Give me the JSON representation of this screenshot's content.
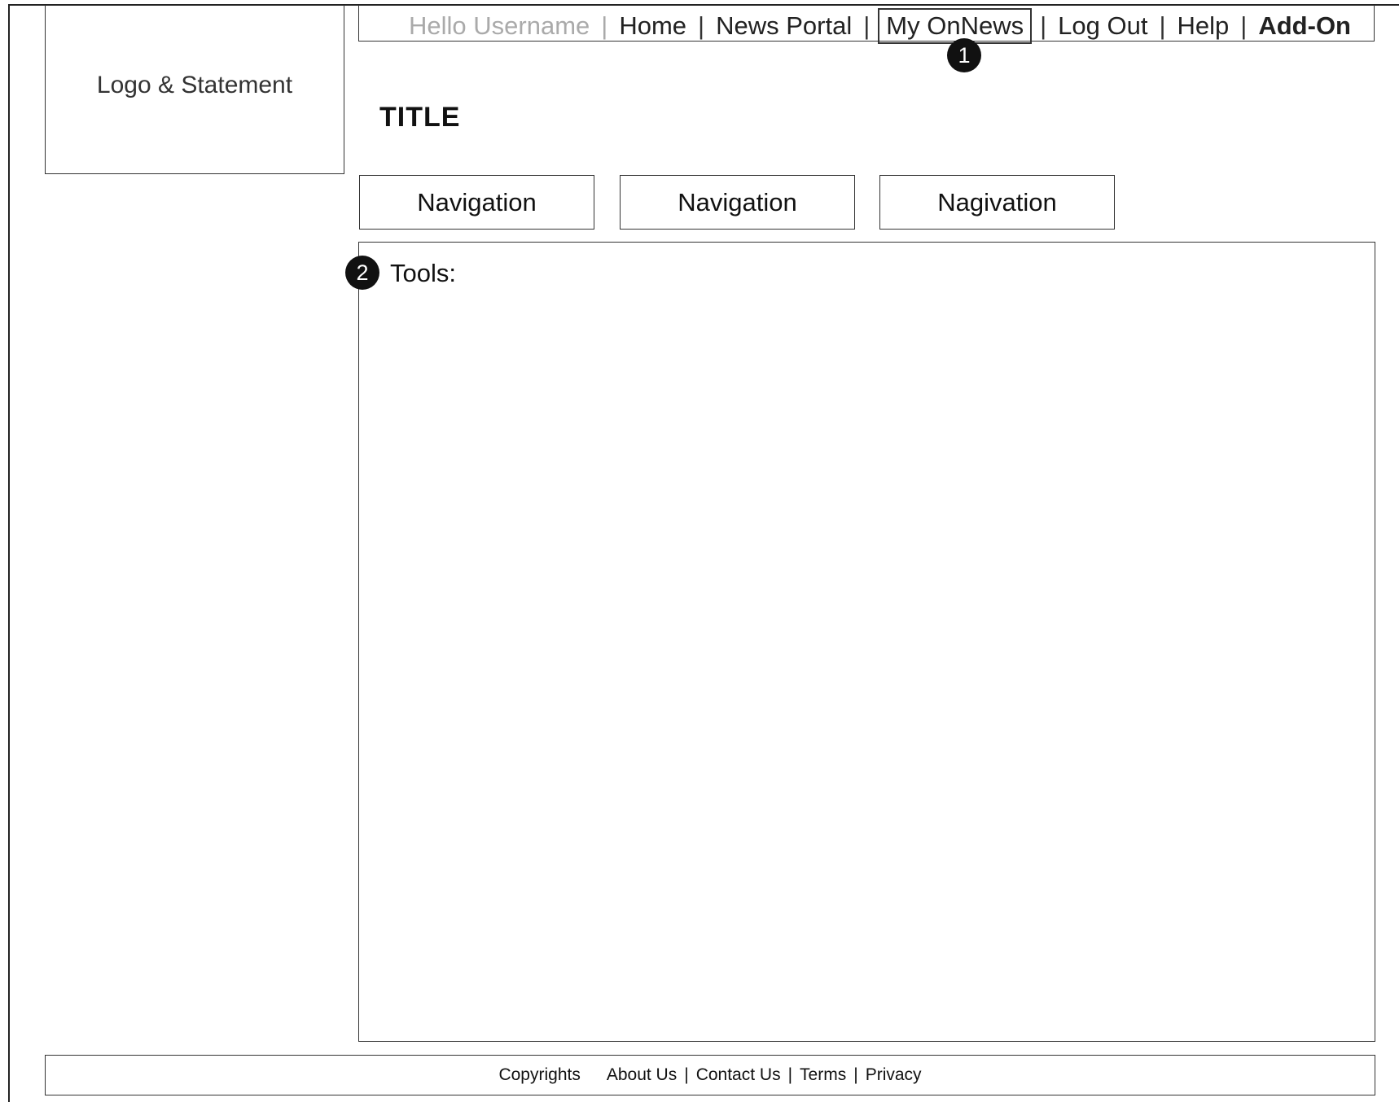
{
  "logo": {
    "text": "Logo & Statement"
  },
  "topnav": {
    "greeting": "Hello Username",
    "links": [
      {
        "label": "Home"
      },
      {
        "label": "News Portal"
      },
      {
        "label": "My OnNews"
      },
      {
        "label": "Log Out"
      },
      {
        "label": "Help"
      },
      {
        "label": "Add-On"
      }
    ],
    "separator": "|"
  },
  "annotations": {
    "badge1": "1",
    "badge2": "2"
  },
  "page": {
    "title": "TITLE"
  },
  "subnav": {
    "items": [
      {
        "label": "Navigation"
      },
      {
        "label": "Navigation"
      },
      {
        "label": "Nagivation"
      }
    ]
  },
  "main": {
    "tools_label": "Tools:"
  },
  "footer": {
    "copyrights": "Copyrights",
    "links": [
      {
        "label": "About Us"
      },
      {
        "label": "Contact Us"
      },
      {
        "label": "Terms"
      },
      {
        "label": "Privacy"
      }
    ],
    "separator": "|"
  }
}
